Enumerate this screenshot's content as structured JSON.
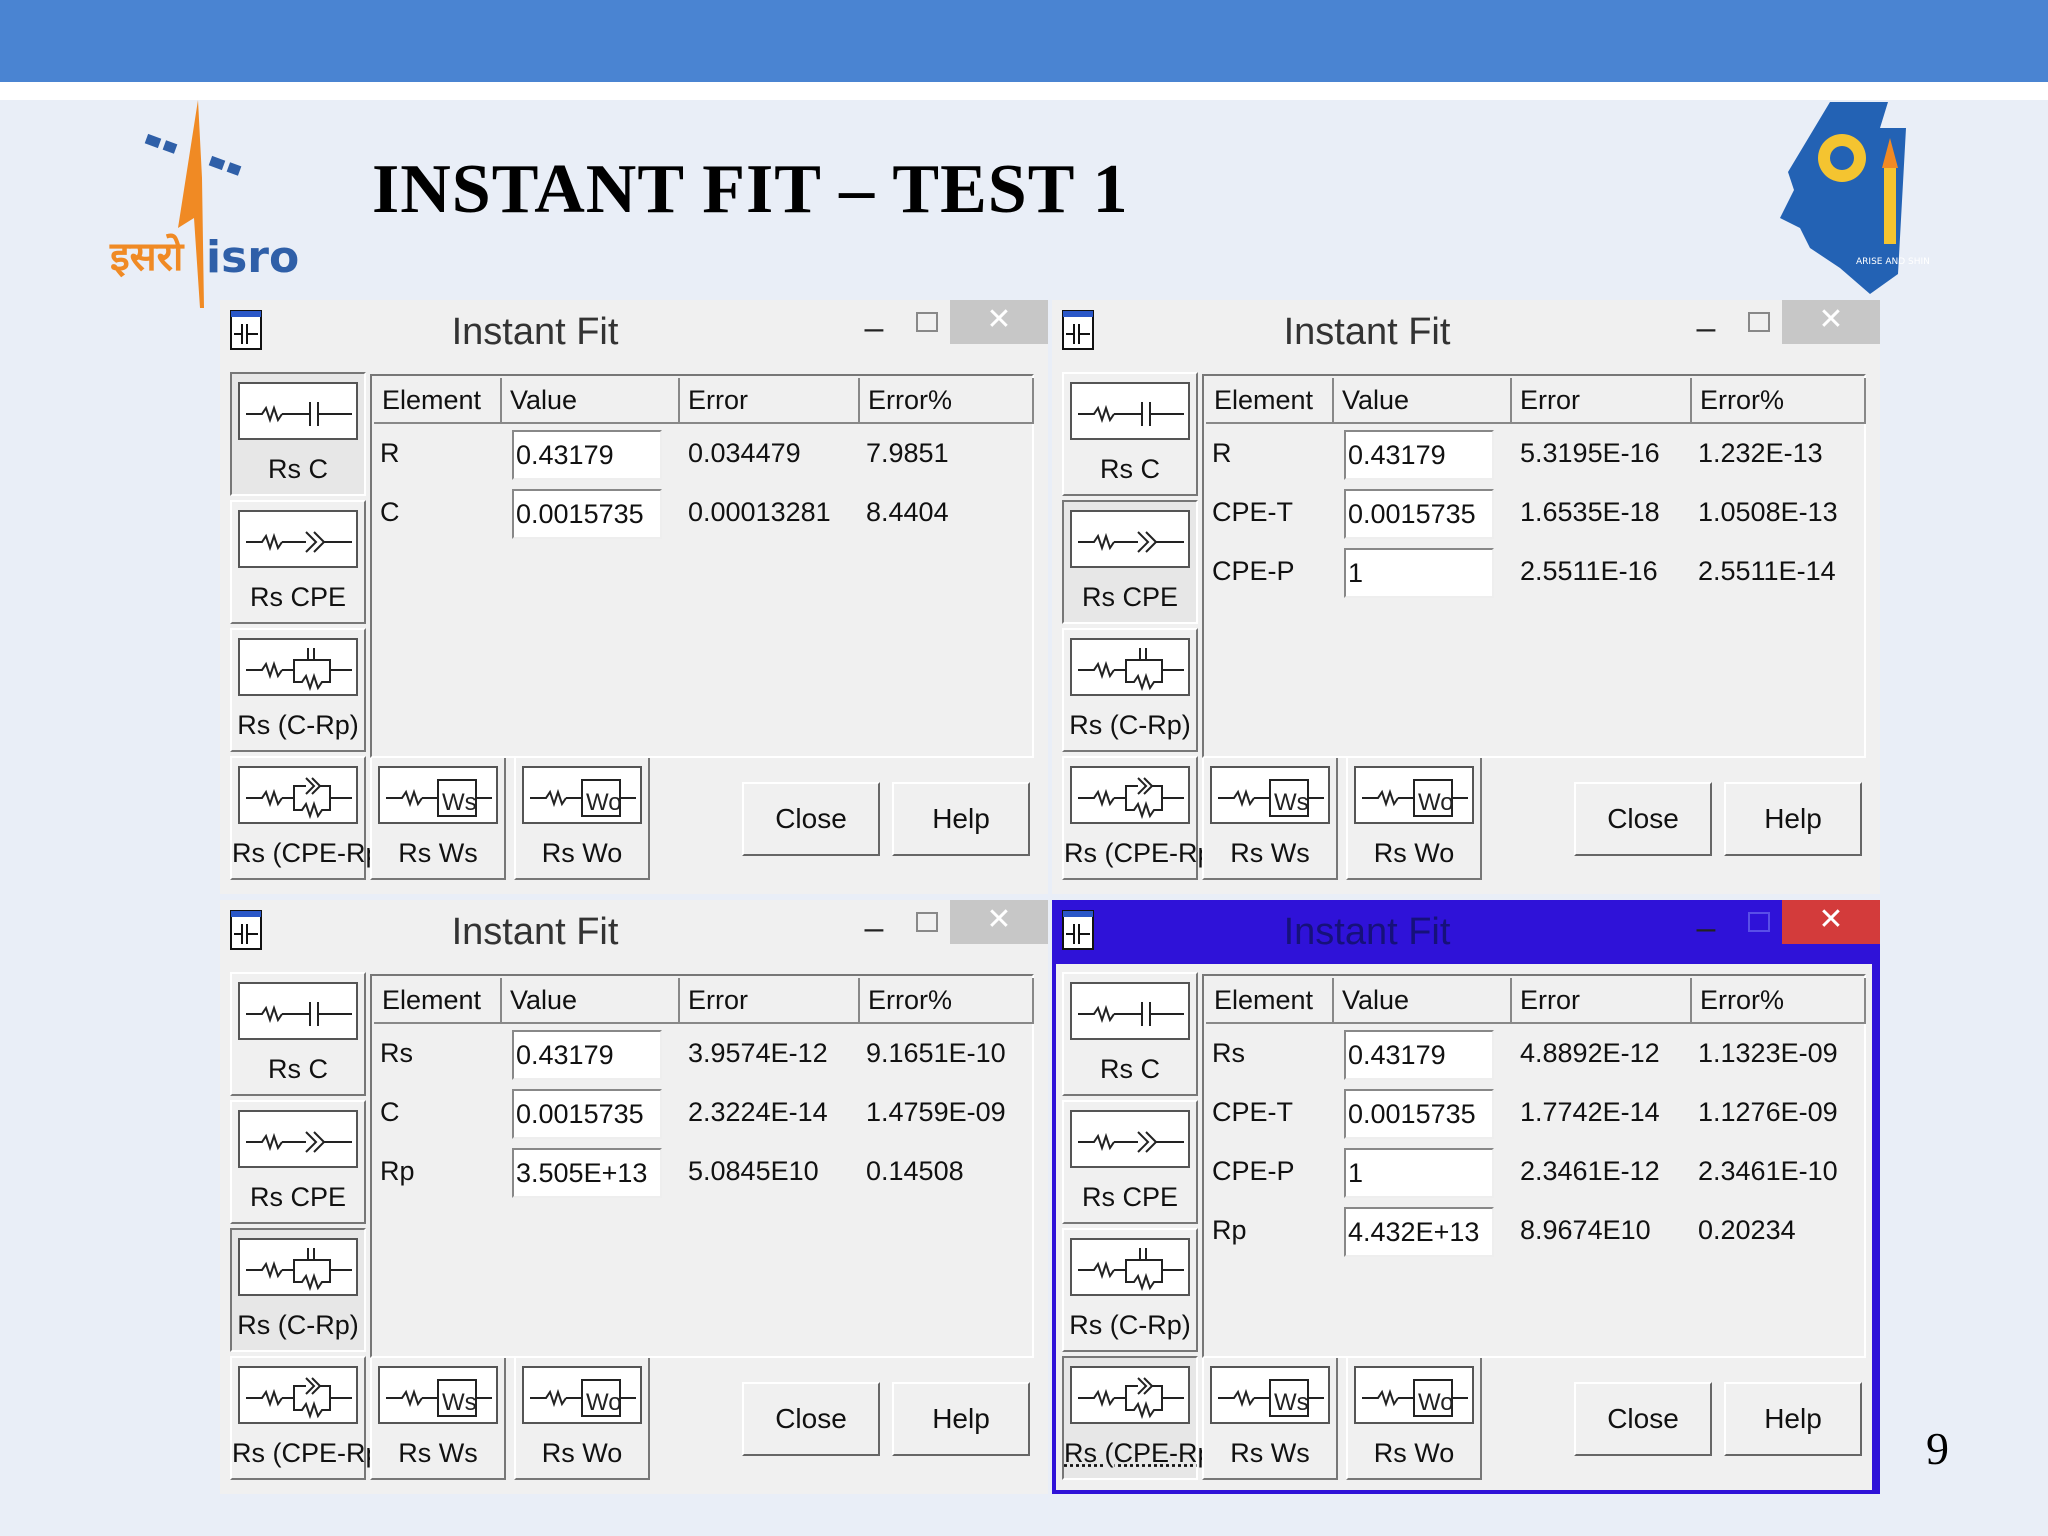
{
  "slide": {
    "title": "INSTANT FIT – TEST 1",
    "page_number": "9",
    "logo_left": {
      "devanagari": "इसरो",
      "latin": "isro"
    },
    "logo_right": {
      "motto": "ARISE AND SHINE"
    }
  },
  "colors": {
    "top_bar": "#4a84d2",
    "background": "#e9eef7",
    "active_window_frame": "#2f12d8",
    "close_active": "#d33b3b"
  },
  "windows": [
    {
      "title": "Instant Fit",
      "active": false,
      "pressed_button": 0,
      "circuit_buttons": [
        "Rs C",
        "Rs CPE",
        "Rs (C-Rp)",
        "Rs (CPE-Rp)",
        "Rs Ws",
        "Rs Wo"
      ],
      "columns": [
        "Element",
        "Value",
        "Error",
        "Error%"
      ],
      "rows": [
        {
          "element": "R",
          "value": "0.43179",
          "error": "0.034479",
          "error_pct": "7.9851"
        },
        {
          "element": "C",
          "value": "0.0015735",
          "error": "0.00013281",
          "error_pct": "8.4404"
        }
      ],
      "close_label": "Close",
      "help_label": "Help"
    },
    {
      "title": "Instant Fit",
      "active": false,
      "pressed_button": 1,
      "circuit_buttons": [
        "Rs C",
        "Rs CPE",
        "Rs (C-Rp)",
        "Rs (CPE-Rp)",
        "Rs Ws",
        "Rs Wo"
      ],
      "columns": [
        "Element",
        "Value",
        "Error",
        "Error%"
      ],
      "rows": [
        {
          "element": "R",
          "value": "0.43179",
          "error": "5.3195E-16",
          "error_pct": "1.232E-13"
        },
        {
          "element": "CPE-T",
          "value": "0.0015735",
          "error": "1.6535E-18",
          "error_pct": "1.0508E-13"
        },
        {
          "element": "CPE-P",
          "value": "1",
          "error": "2.5511E-16",
          "error_pct": "2.5511E-14"
        }
      ],
      "close_label": "Close",
      "help_label": "Help"
    },
    {
      "title": "Instant Fit",
      "active": false,
      "pressed_button": 2,
      "circuit_buttons": [
        "Rs C",
        "Rs CPE",
        "Rs (C-Rp)",
        "Rs (CPE-Rp)",
        "Rs Ws",
        "Rs Wo"
      ],
      "columns": [
        "Element",
        "Value",
        "Error",
        "Error%"
      ],
      "rows": [
        {
          "element": "Rs",
          "value": "0.43179",
          "error": "3.9574E-12",
          "error_pct": "9.1651E-10"
        },
        {
          "element": "C",
          "value": "0.0015735",
          "error": "2.3224E-14",
          "error_pct": "1.4759E-09"
        },
        {
          "element": "Rp",
          "value": "3.505E+13",
          "error": "5.0845E10",
          "error_pct": "0.14508"
        }
      ],
      "close_label": "Close",
      "help_label": "Help"
    },
    {
      "title": "Instant Fit",
      "active": true,
      "pressed_button": 3,
      "circuit_buttons": [
        "Rs C",
        "Rs CPE",
        "Rs (C-Rp)",
        "Rs (CPE-Rp)",
        "Rs Ws",
        "Rs Wo"
      ],
      "columns": [
        "Element",
        "Value",
        "Error",
        "Error%"
      ],
      "rows": [
        {
          "element": "Rs",
          "value": "0.43179",
          "error": "4.8892E-12",
          "error_pct": "1.1323E-09"
        },
        {
          "element": "CPE-T",
          "value": "0.0015735",
          "error": "1.7742E-14",
          "error_pct": "1.1276E-09"
        },
        {
          "element": "CPE-P",
          "value": "1",
          "error": "2.3461E-12",
          "error_pct": "2.3461E-10"
        },
        {
          "element": "Rp",
          "value": "4.432E+13",
          "error": "8.9674E10",
          "error_pct": "0.20234"
        }
      ],
      "close_label": "Close",
      "help_label": "Help"
    }
  ]
}
